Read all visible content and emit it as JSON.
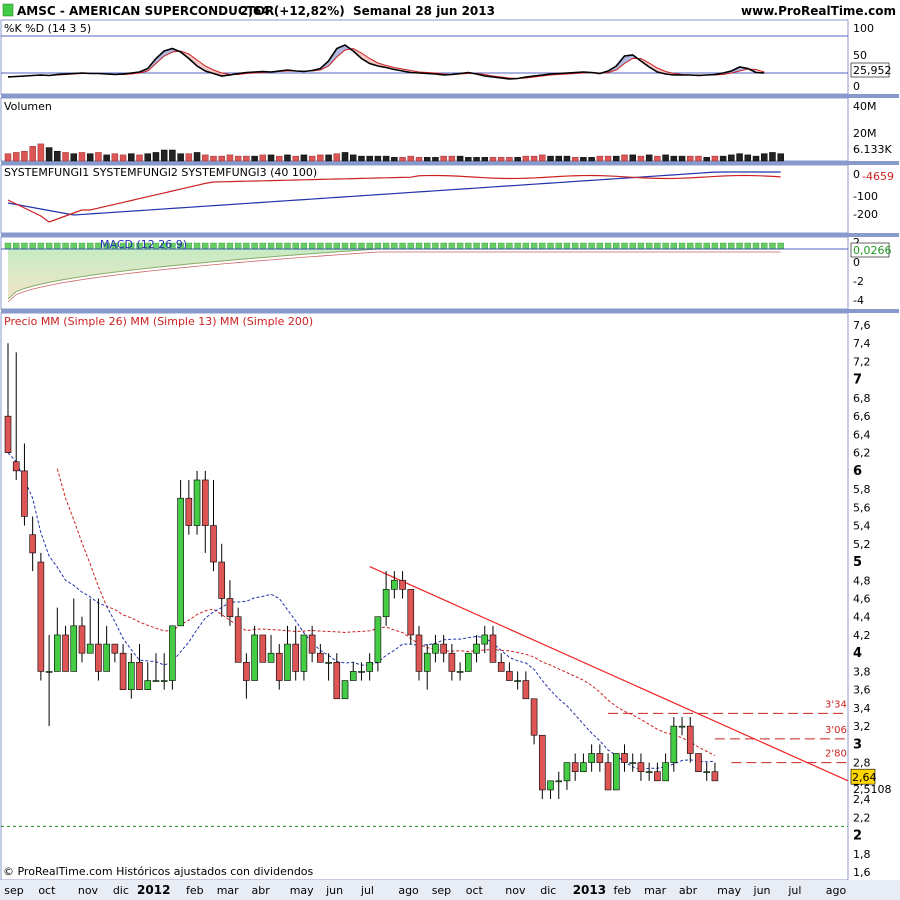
{
  "header": {
    "title": "AMSC - AMERICAN SUPERCONDUCTOR",
    "price": "2,64 (+12,82%)",
    "period": "Semanal  28 jun 2013",
    "site": "www.ProRealTime.com"
  },
  "footer": {
    "note": "© ProRealTime.com Históricos ajustados con dividendos"
  },
  "colors": {
    "up": "#44cc44",
    "down": "#dd5555",
    "ema_red": "#cc2222",
    "ema_blue": "#2233aa",
    "price_box": "#ffd700",
    "panel_border": "#8899cc",
    "trend": "#ee2222"
  },
  "x_axis": {
    "labels": [
      {
        "i": 0,
        "t": "sep"
      },
      {
        "i": 4,
        "t": "oct"
      },
      {
        "i": 9,
        "t": "nov"
      },
      {
        "i": 13,
        "t": "dic"
      },
      {
        "i": 17,
        "t": "2012",
        "bold": true
      },
      {
        "i": 22,
        "t": "feb"
      },
      {
        "i": 26,
        "t": "mar"
      },
      {
        "i": 30,
        "t": "abr"
      },
      {
        "i": 35,
        "t": "may"
      },
      {
        "i": 39,
        "t": "jun"
      },
      {
        "i": 43,
        "t": "jul"
      },
      {
        "i": 48,
        "t": "ago"
      },
      {
        "i": 52,
        "t": "sep"
      },
      {
        "i": 56,
        "t": "oct"
      },
      {
        "i": 61,
        "t": "nov"
      },
      {
        "i": 65,
        "t": "dic"
      },
      {
        "i": 70,
        "t": "2013",
        "bold": true
      },
      {
        "i": 74,
        "t": "feb"
      },
      {
        "i": 78,
        "t": "mar"
      },
      {
        "i": 82,
        "t": "abr"
      },
      {
        "i": 87,
        "t": "may"
      },
      {
        "i": 91,
        "t": "jun"
      },
      {
        "i": 95,
        "t": "jul"
      },
      {
        "i": 100,
        "t": "ago"
      }
    ]
  },
  "chart_data": [
    {
      "id": "stoch",
      "type": "line",
      "title": "%K %D (14 3 5)",
      "ylim": [
        0,
        100
      ],
      "y_ticks": [
        "100",
        "50",
        "0"
      ],
      "last_value": "25,952",
      "series": [
        {
          "name": "%K",
          "values": [
            18,
            19,
            20,
            21,
            22,
            21,
            23,
            24,
            25,
            26,
            25,
            25,
            24,
            23,
            24,
            26,
            28,
            35,
            55,
            70,
            75,
            68,
            55,
            40,
            30,
            25,
            20,
            22,
            25,
            27,
            28,
            29,
            28,
            30,
            32,
            30,
            29,
            31,
            35,
            50,
            75,
            82,
            70,
            55,
            45,
            40,
            37,
            33,
            30,
            27,
            26,
            25,
            24,
            22,
            23,
            25,
            27,
            24,
            20,
            18,
            16,
            14,
            15,
            18,
            20,
            22,
            24,
            25,
            26,
            27,
            28,
            27,
            25,
            30,
            40,
            60,
            62,
            50,
            38,
            28,
            24,
            22,
            22,
            22,
            21,
            22,
            23,
            26,
            30,
            38,
            35,
            27,
            26
          ]
        },
        {
          "name": "%D",
          "values": [
            19,
            19,
            20,
            21,
            21,
            21,
            22,
            23,
            24,
            25,
            25,
            25,
            24,
            23,
            23,
            24,
            26,
            30,
            45,
            60,
            68,
            70,
            64,
            52,
            40,
            32,
            26,
            23,
            23,
            25,
            26,
            27,
            28,
            29,
            30,
            30,
            30,
            30,
            32,
            40,
            58,
            72,
            75,
            66,
            55,
            46,
            41,
            37,
            34,
            31,
            28,
            27,
            26,
            24,
            23,
            24,
            25,
            25,
            23,
            20,
            18,
            16,
            15,
            16,
            18,
            20,
            22,
            23,
            24,
            25,
            26,
            27,
            26,
            27,
            32,
            45,
            55,
            55,
            46,
            36,
            29,
            25,
            23,
            22,
            22,
            22,
            22,
            23,
            26,
            30,
            34,
            33,
            28
          ]
        }
      ]
    },
    {
      "id": "volume",
      "type": "bar",
      "title": "Volumen",
      "y_ticks": [
        "40M",
        "20M"
      ],
      "last_value": "6.133K",
      "values": [
        6,
        7,
        8,
        12,
        14,
        11,
        8,
        7,
        6,
        7,
        6,
        7,
        5,
        6,
        5,
        6,
        5,
        6,
        7,
        9,
        9,
        6,
        6,
        7,
        5,
        4,
        4,
        5,
        4,
        4,
        4,
        5,
        5,
        4,
        5,
        4,
        5,
        4,
        5,
        5,
        6,
        7,
        5,
        4,
        4,
        4,
        4,
        3,
        3,
        4,
        3,
        3,
        3,
        4,
        4,
        4,
        3,
        3,
        3,
        3,
        3,
        3,
        3,
        4,
        4,
        5,
        4,
        4,
        4,
        3,
        3,
        3,
        4,
        4,
        4,
        5,
        5,
        4,
        5,
        4,
        5,
        4,
        4,
        4,
        4,
        3,
        4,
        4,
        5,
        6,
        5,
        4,
        6,
        7,
        6,
        5,
        6,
        7
      ]
    },
    {
      "id": "systemfungi",
      "type": "line",
      "title": "SYSTEMFUNGI1 SYSTEMFUNGI2 SYSTEMFUNGI3 (40 100)",
      "y_ticks": [
        "0",
        "-100",
        "-200"
      ],
      "last_value": "-4659"
    },
    {
      "id": "macd",
      "type": "area",
      "title": "MACD (12 26 9)",
      "y_ticks": [
        "2",
        "0",
        "-2",
        "-4"
      ],
      "last_value": "0,0266"
    },
    {
      "id": "price",
      "type": "candlestick",
      "title": "Precio MM (Simple 26) MM (Simple 13) MM (Simple 200)",
      "ylim": [
        1.6,
        7.7
      ],
      "y_ticks": [
        "7,6",
        "7,4",
        "7,2",
        "7",
        "6,8",
        "6,6",
        "6,4",
        "6,2",
        "6",
        "5,8",
        "5,6",
        "5,4",
        "5,2",
        "5",
        "4,8",
        "4,6",
        "4,4",
        "4,2",
        "4",
        "3,8",
        "3,6",
        "3,4",
        "3,2",
        "3",
        "2,8",
        "2,6",
        "2,4",
        "2,2",
        "2",
        "1,8",
        "1,6"
      ],
      "last_price": "2,64",
      "ma_value": "2,5108",
      "levels": [
        {
          "v": 3.34,
          "t": "3'34"
        },
        {
          "v": 3.06,
          "t": "3'06"
        },
        {
          "v": 2.8,
          "t": "2'80"
        }
      ],
      "support": 2.1,
      "candles": [
        {
          "o": 6.6,
          "h": 7.4,
          "l": 6.2,
          "c": 6.2
        },
        {
          "o": 6.1,
          "h": 7.3,
          "l": 5.9,
          "c": 6.0
        },
        {
          "o": 6.0,
          "h": 6.3,
          "l": 5.4,
          "c": 5.5
        },
        {
          "o": 5.3,
          "h": 5.5,
          "l": 4.9,
          "c": 5.1
        },
        {
          "o": 5.0,
          "h": 5.1,
          "l": 3.7,
          "c": 3.8
        },
        {
          "o": 3.8,
          "h": 4.2,
          "l": 3.2,
          "c": 3.8
        },
        {
          "o": 3.8,
          "h": 4.5,
          "l": 3.8,
          "c": 4.2
        },
        {
          "o": 4.2,
          "h": 4.3,
          "l": 3.8,
          "c": 3.8
        },
        {
          "o": 3.8,
          "h": 4.6,
          "l": 3.8,
          "c": 4.3
        },
        {
          "o": 4.3,
          "h": 4.4,
          "l": 3.9,
          "c": 4.0
        },
        {
          "o": 4.0,
          "h": 4.6,
          "l": 4.0,
          "c": 4.1
        },
        {
          "o": 4.1,
          "h": 4.6,
          "l": 3.7,
          "c": 3.8
        },
        {
          "o": 3.8,
          "h": 4.3,
          "l": 3.8,
          "c": 4.1
        },
        {
          "o": 4.1,
          "h": 4.1,
          "l": 3.9,
          "c": 4.0
        },
        {
          "o": 4.0,
          "h": 4.1,
          "l": 3.6,
          "c": 3.6
        },
        {
          "o": 3.6,
          "h": 4.0,
          "l": 3.5,
          "c": 3.9
        },
        {
          "o": 3.9,
          "h": 4.1,
          "l": 3.6,
          "c": 3.6
        },
        {
          "o": 3.6,
          "h": 3.9,
          "l": 3.6,
          "c": 3.7
        },
        {
          "o": 3.7,
          "h": 4.0,
          "l": 3.7,
          "c": 3.7
        },
        {
          "o": 3.7,
          "h": 4.0,
          "l": 3.6,
          "c": 3.7
        },
        {
          "o": 3.7,
          "h": 4.3,
          "l": 3.6,
          "c": 4.3
        },
        {
          "o": 4.3,
          "h": 5.9,
          "l": 4.3,
          "c": 5.7
        },
        {
          "o": 5.7,
          "h": 5.9,
          "l": 5.3,
          "c": 5.4
        },
        {
          "o": 5.4,
          "h": 6.0,
          "l": 5.3,
          "c": 5.9
        },
        {
          "o": 5.9,
          "h": 6.0,
          "l": 5.1,
          "c": 5.4
        },
        {
          "o": 5.4,
          "h": 5.9,
          "l": 4.9,
          "c": 5.0
        },
        {
          "o": 5.0,
          "h": 5.2,
          "l": 4.4,
          "c": 4.6
        },
        {
          "o": 4.6,
          "h": 4.8,
          "l": 4.3,
          "c": 4.4
        },
        {
          "o": 4.4,
          "h": 4.5,
          "l": 3.9,
          "c": 3.9
        },
        {
          "o": 3.9,
          "h": 4.0,
          "l": 3.5,
          "c": 3.7
        },
        {
          "o": 3.7,
          "h": 4.3,
          "l": 3.7,
          "c": 4.2
        },
        {
          "o": 4.2,
          "h": 4.2,
          "l": 3.9,
          "c": 3.9
        },
        {
          "o": 3.9,
          "h": 4.2,
          "l": 3.9,
          "c": 4.0
        },
        {
          "o": 4.0,
          "h": 4.1,
          "l": 3.6,
          "c": 3.7
        },
        {
          "o": 3.7,
          "h": 4.3,
          "l": 3.7,
          "c": 4.1
        },
        {
          "o": 4.1,
          "h": 4.3,
          "l": 3.7,
          "c": 3.8
        },
        {
          "o": 3.8,
          "h": 4.2,
          "l": 3.7,
          "c": 4.2
        },
        {
          "o": 4.2,
          "h": 4.3,
          "l": 3.9,
          "c": 4.0
        },
        {
          "o": 4.0,
          "h": 4.1,
          "l": 3.9,
          "c": 3.9
        },
        {
          "o": 3.9,
          "h": 4.0,
          "l": 3.7,
          "c": 3.9
        },
        {
          "o": 3.9,
          "h": 4.0,
          "l": 3.5,
          "c": 3.5
        },
        {
          "o": 3.5,
          "h": 3.7,
          "l": 3.5,
          "c": 3.7
        },
        {
          "o": 3.7,
          "h": 3.9,
          "l": 3.7,
          "c": 3.8
        },
        {
          "o": 3.8,
          "h": 3.9,
          "l": 3.7,
          "c": 3.8
        },
        {
          "o": 3.8,
          "h": 4.0,
          "l": 3.7,
          "c": 3.9
        },
        {
          "o": 3.9,
          "h": 4.4,
          "l": 3.8,
          "c": 4.4
        },
        {
          "o": 4.4,
          "h": 4.9,
          "l": 4.3,
          "c": 4.7
        },
        {
          "o": 4.7,
          "h": 4.9,
          "l": 4.6,
          "c": 4.8
        },
        {
          "o": 4.8,
          "h": 4.9,
          "l": 4.6,
          "c": 4.7
        },
        {
          "o": 4.7,
          "h": 4.7,
          "l": 4.1,
          "c": 4.2
        },
        {
          "o": 4.2,
          "h": 4.3,
          "l": 3.7,
          "c": 3.8
        },
        {
          "o": 3.8,
          "h": 4.1,
          "l": 3.6,
          "c": 4.0
        },
        {
          "o": 4.0,
          "h": 4.2,
          "l": 3.9,
          "c": 4.1
        },
        {
          "o": 4.1,
          "h": 4.2,
          "l": 3.9,
          "c": 4.0
        },
        {
          "o": 4.0,
          "h": 4.1,
          "l": 3.7,
          "c": 3.8
        },
        {
          "o": 3.8,
          "h": 3.9,
          "l": 3.7,
          "c": 3.8
        },
        {
          "o": 3.8,
          "h": 4.0,
          "l": 3.8,
          "c": 4.0
        },
        {
          "o": 4.0,
          "h": 4.2,
          "l": 3.9,
          "c": 4.1
        },
        {
          "o": 4.1,
          "h": 4.3,
          "l": 4.0,
          "c": 4.2
        },
        {
          "o": 4.2,
          "h": 4.3,
          "l": 3.9,
          "c": 3.9
        },
        {
          "o": 3.9,
          "h": 4.0,
          "l": 3.8,
          "c": 3.8
        },
        {
          "o": 3.8,
          "h": 3.9,
          "l": 3.7,
          "c": 3.7
        },
        {
          "o": 3.7,
          "h": 3.8,
          "l": 3.6,
          "c": 3.7
        },
        {
          "o": 3.7,
          "h": 3.8,
          "l": 3.5,
          "c": 3.5
        },
        {
          "o": 3.5,
          "h": 3.5,
          "l": 3.0,
          "c": 3.1
        },
        {
          "o": 3.1,
          "h": 3.1,
          "l": 2.4,
          "c": 2.5
        },
        {
          "o": 2.5,
          "h": 2.6,
          "l": 2.4,
          "c": 2.6
        },
        {
          "o": 2.6,
          "h": 2.7,
          "l": 2.4,
          "c": 2.6
        },
        {
          "o": 2.6,
          "h": 2.8,
          "l": 2.5,
          "c": 2.8
        },
        {
          "o": 2.8,
          "h": 2.9,
          "l": 2.6,
          "c": 2.7
        },
        {
          "o": 2.7,
          "h": 2.9,
          "l": 2.7,
          "c": 2.8
        },
        {
          "o": 2.8,
          "h": 3.0,
          "l": 2.7,
          "c": 2.9
        },
        {
          "o": 2.9,
          "h": 3.0,
          "l": 2.7,
          "c": 2.8
        },
        {
          "o": 2.8,
          "h": 2.9,
          "l": 2.5,
          "c": 2.5
        },
        {
          "o": 2.5,
          "h": 2.9,
          "l": 2.5,
          "c": 2.9
        },
        {
          "o": 2.9,
          "h": 3.0,
          "l": 2.7,
          "c": 2.8
        },
        {
          "o": 2.8,
          "h": 2.9,
          "l": 2.7,
          "c": 2.8
        },
        {
          "o": 2.8,
          "h": 2.9,
          "l": 2.6,
          "c": 2.7
        },
        {
          "o": 2.7,
          "h": 2.8,
          "l": 2.6,
          "c": 2.7
        },
        {
          "o": 2.7,
          "h": 2.8,
          "l": 2.6,
          "c": 2.6
        },
        {
          "o": 2.6,
          "h": 2.9,
          "l": 2.6,
          "c": 2.8
        },
        {
          "o": 2.8,
          "h": 3.3,
          "l": 2.7,
          "c": 3.2
        },
        {
          "o": 3.2,
          "h": 3.3,
          "l": 3.1,
          "c": 3.2
        },
        {
          "o": 3.2,
          "h": 3.3,
          "l": 2.8,
          "c": 2.9
        },
        {
          "o": 2.9,
          "h": 2.9,
          "l": 2.7,
          "c": 2.7
        },
        {
          "o": 2.7,
          "h": 2.8,
          "l": 2.6,
          "c": 2.7
        },
        {
          "o": 2.7,
          "h": 2.8,
          "l": 2.6,
          "c": 2.6
        }
      ]
    }
  ]
}
